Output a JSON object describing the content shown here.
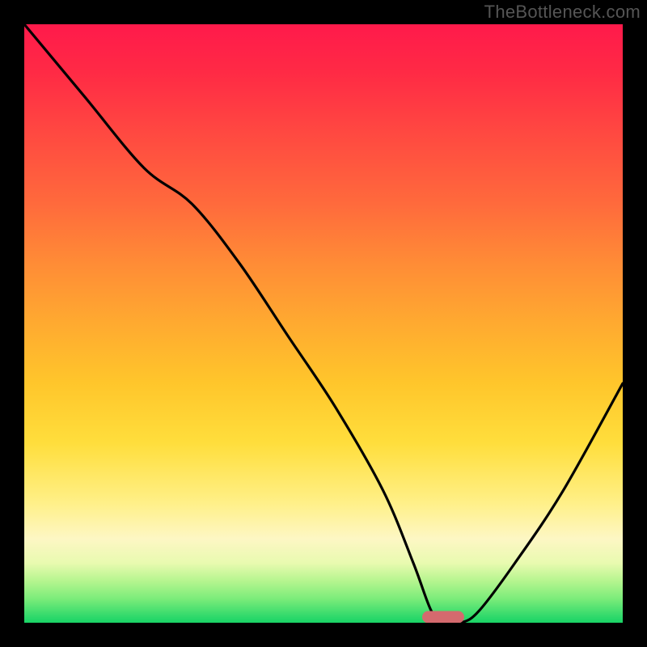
{
  "watermark": "TheBottleneck.com",
  "colors": {
    "frame_bg": "#000000",
    "curve": "#000000",
    "marker": "#d46a6e",
    "gradient_top": "#ff1a4b",
    "gradient_bottom": "#19d466"
  },
  "chart_data": {
    "type": "line",
    "title": "",
    "xlabel": "",
    "ylabel": "",
    "xlim": [
      0,
      100
    ],
    "ylim": [
      0,
      100
    ],
    "grid": false,
    "legend": false,
    "notes": "Background is a vertical heat gradient (red=high bottleneck risk at top, green=optimal at bottom). Black curve is a V-shaped profile; minimum (optimal point) marked by a red pill near x≈70. No axis ticks or labels are rendered.",
    "series": [
      {
        "name": "bottleneck-curve",
        "x": [
          0,
          10,
          20,
          28,
          36,
          44,
          52,
          60,
          65,
          68,
          70,
          73,
          76,
          82,
          90,
          100
        ],
        "values": [
          100,
          88,
          76,
          70,
          60,
          48,
          36,
          22,
          10,
          2,
          0,
          0,
          2,
          10,
          22,
          40
        ]
      }
    ],
    "marker": {
      "x": 70,
      "y": 0,
      "label": ""
    }
  }
}
